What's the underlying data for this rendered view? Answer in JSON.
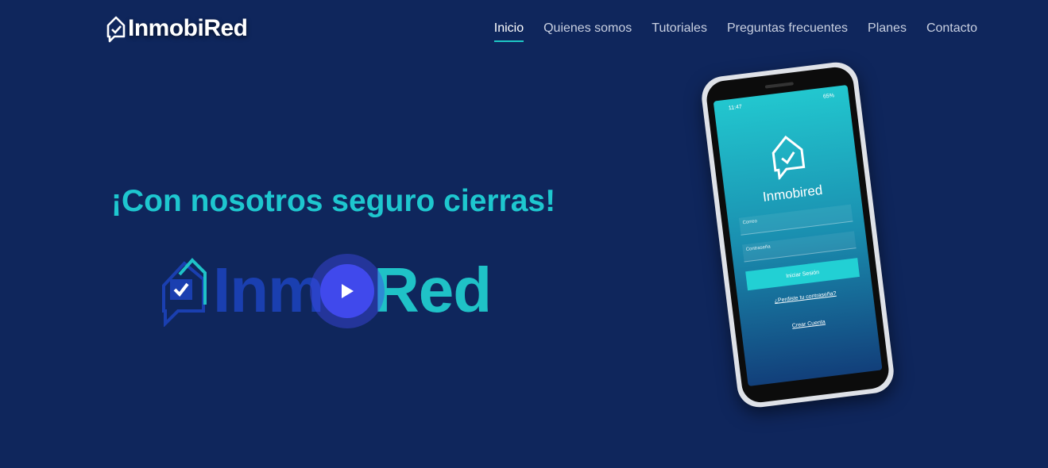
{
  "brand": {
    "name": "InmobiRed"
  },
  "nav": {
    "items": [
      {
        "label": "Inicio",
        "active": true
      },
      {
        "label": "Quienes somos"
      },
      {
        "label": "Tutoriales"
      },
      {
        "label": "Preguntas frecuentes"
      },
      {
        "label": "Planes"
      },
      {
        "label": "Contacto"
      }
    ]
  },
  "hero": {
    "headline": "¡Con nosotros seguro cierras!",
    "video_logo_part1": "Inmo",
    "video_logo_part2": "Red"
  },
  "phone": {
    "status_time": "11:47",
    "status_battery": "65%",
    "app_name": "Inmobired",
    "email_placeholder": "Correo",
    "password_placeholder": "Contraseña",
    "login_button": "Iniciar Sesión",
    "forgot_link": "¿Perdiste tu contraseña?",
    "create_link": "Crear Cuenta"
  },
  "colors": {
    "background": "#0f265c",
    "accent_teal": "#1ec7cf",
    "play_button": "#4049ec",
    "wordmark_blue": "#1a3fb0"
  },
  "icons": {
    "logo": "house-chat-check-icon",
    "play": "play-icon"
  }
}
